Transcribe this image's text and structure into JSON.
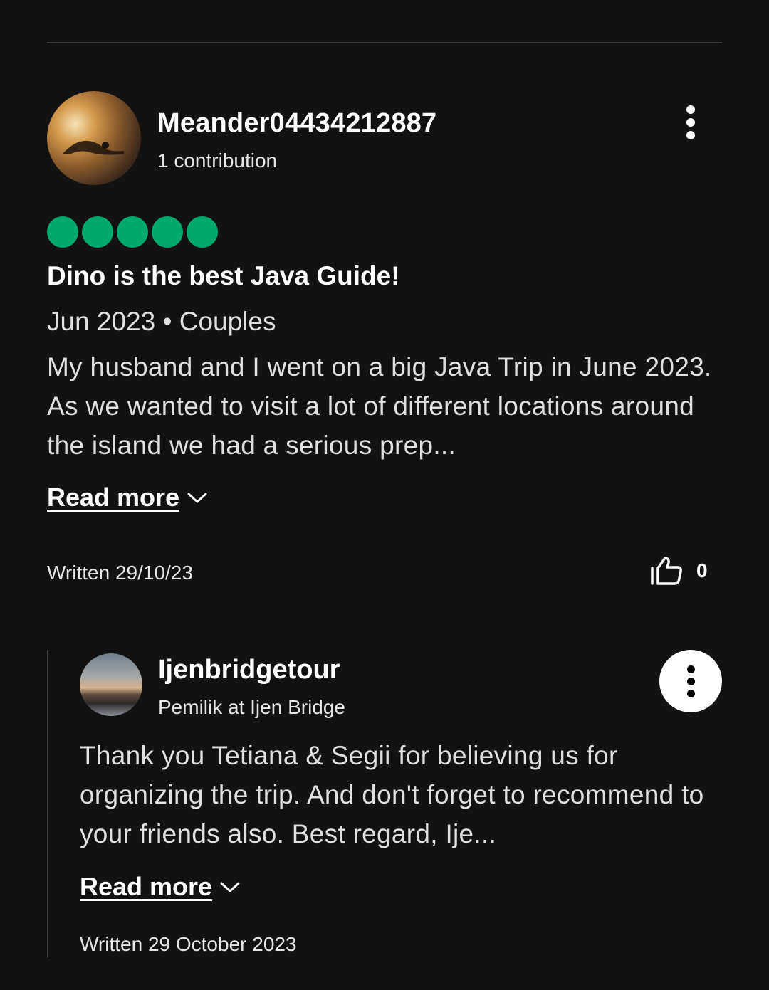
{
  "review": {
    "username": "Meander04434212887",
    "contributions": "1 contribution",
    "rating": 5,
    "title": "Dino is the best Java Guide!",
    "meta": "Jun 2023 • Couples",
    "body": "My husband and I went on a big Java Trip in June 2023. As we wanted to visit a lot of different locations around the island we had a serious prep...",
    "read_more": "Read more",
    "written": "Written 29/10/23",
    "helpful_count": "0"
  },
  "reply": {
    "name": "Ijenbridgetour",
    "role": "Pemilik at Ijen Bridge",
    "body": "Thank you Tetiana & Segii for believing us for organizing the trip. And don't forget to recommend to your friends also. Best regard, Ije...",
    "read_more": "Read more",
    "written": "Written 29 October 2023"
  },
  "colors": {
    "background": "#121212",
    "rating_bubble": "#00aa6c",
    "text_primary": "#ffffff",
    "text_secondary": "#e0e0e0"
  },
  "icons": {
    "more": "kebab-vertical",
    "read_more": "chevron-down",
    "helpful": "thumbs-up-outline"
  }
}
